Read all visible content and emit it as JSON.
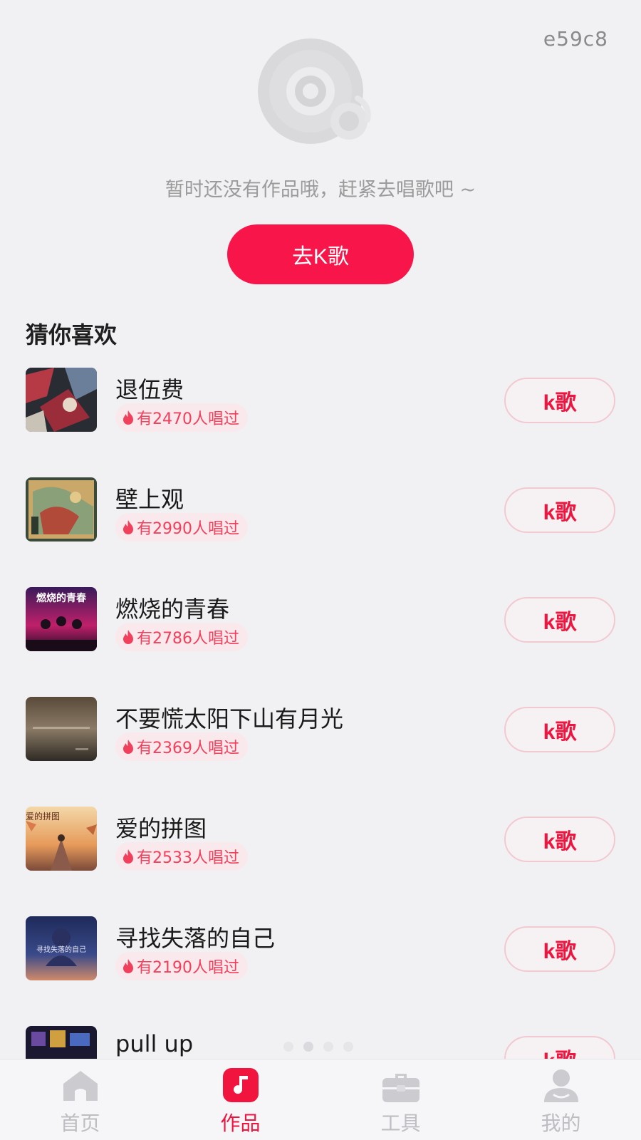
{
  "header": {
    "user_code": "e59c8"
  },
  "empty_state": {
    "message": "暂时还没有作品哦，赶紧去唱歌吧 ~",
    "button_label": "去K歌"
  },
  "recommend": {
    "title": "猜你喜欢",
    "songs": [
      {
        "title": "退伍费",
        "sung": "有2470人唱过",
        "button": "k歌"
      },
      {
        "title": "壁上观",
        "sung": "有2990人唱过",
        "button": "k歌"
      },
      {
        "title": "燃烧的青春",
        "sung": "有2786人唱过",
        "button": "k歌",
        "cover_text": "燃烧的青春"
      },
      {
        "title": "不要慌太阳下山有月光",
        "sung": "有2369人唱过",
        "button": "k歌"
      },
      {
        "title": "爱的拼图",
        "sung": "有2533人唱过",
        "button": "k歌",
        "cover_text": "爱的拼图"
      },
      {
        "title": "寻找失落的自己",
        "sung": "有2190人唱过",
        "button": "k歌",
        "cover_text": "寻找失落的自己"
      },
      {
        "title": "pull up",
        "sung": "",
        "button": "k歌"
      }
    ]
  },
  "tabs": [
    {
      "label": "首页",
      "icon": "home-icon",
      "active": false
    },
    {
      "label": "作品",
      "icon": "music-note-icon",
      "active": true
    },
    {
      "label": "工具",
      "icon": "toolbox-icon",
      "active": false
    },
    {
      "label": "我的",
      "icon": "person-icon",
      "active": false
    }
  ],
  "colors": {
    "accent": "#f8154a",
    "background": "#f1f0f3",
    "badge_bg": "#f9e9ec",
    "badge_text": "#f0405c"
  }
}
